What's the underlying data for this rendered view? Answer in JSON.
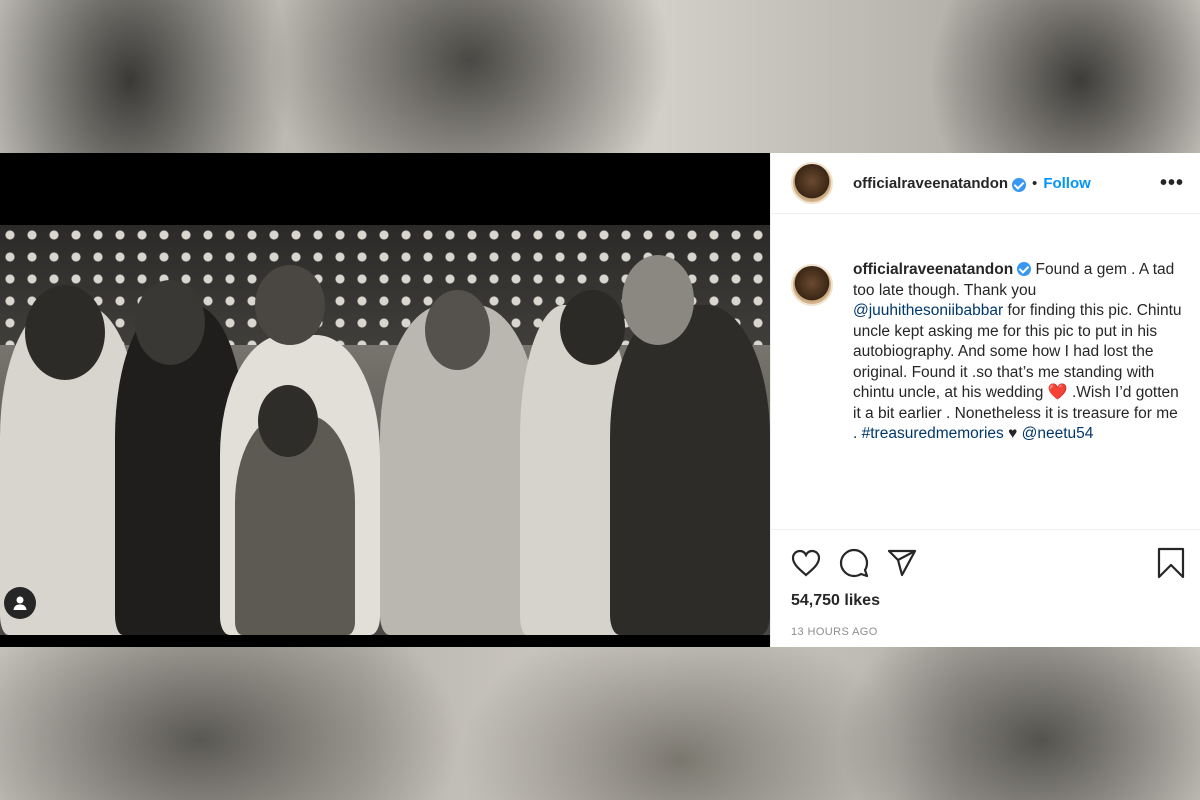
{
  "post": {
    "username": "officialraveenatandon",
    "follow_label": "Follow",
    "separator": "•",
    "more_label": "•••",
    "caption": {
      "p1": "Found a gem . A tad too late though. Thank you ",
      "mention1": "@juuhithesoniibabbar",
      "p2": " for finding this pic. Chintu uncle kept asking me for this pic to put in his autobiography. And some how I had lost the original. Found it .so that’s me standing with chintu uncle, at his wedding ",
      "heart": "❤️",
      "p3": " .Wish I’d gotten it a bit earlier . Nonetheless it is treasure for me . ",
      "hashtag": "#treasuredmemories",
      "p4": " ♥ ",
      "mention2": "@neetu54"
    },
    "likes": "54,750 likes",
    "timestamp": "13 HOURS AGO"
  },
  "icons": {
    "like": "heart-icon",
    "comment": "comment-icon",
    "share": "share-icon",
    "save": "bookmark-icon",
    "tagged_user": "user-icon",
    "verified": "verified-badge-icon"
  },
  "colors": {
    "follow": "#0095f6",
    "link": "#00376b",
    "verified": "#3897f0"
  }
}
